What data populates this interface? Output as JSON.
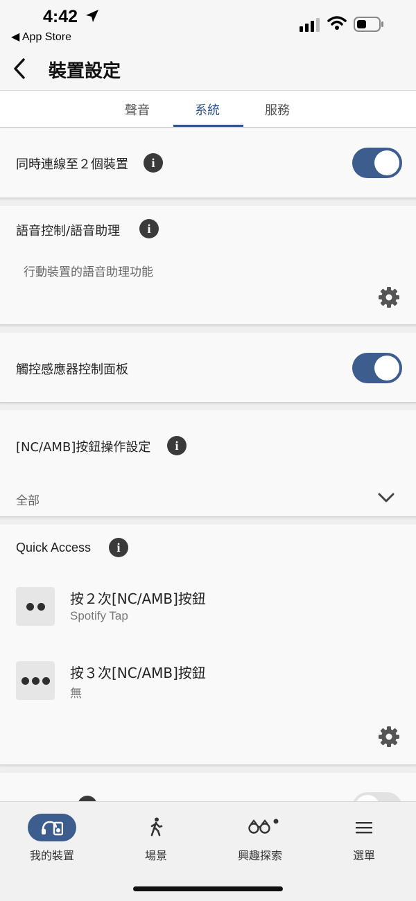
{
  "status_bar": {
    "time": "4:42",
    "back_app": "◀ App Store"
  },
  "header": {
    "title": "裝置設定"
  },
  "tabs": [
    {
      "label": "聲音",
      "active": false
    },
    {
      "label": "系統",
      "active": true
    },
    {
      "label": "服務",
      "active": false
    }
  ],
  "settings": {
    "dual_connect": {
      "label": "同時連線至２個裝置",
      "enabled": true
    },
    "voice": {
      "label": "語音控制/語音助理",
      "value": "行動裝置的語音助理功能"
    },
    "touch_panel": {
      "label": "觸控感應器控制面板",
      "enabled": true
    },
    "nc_amb": {
      "label": "[NC/AMB]按鈕操作設定",
      "selected": "全部"
    },
    "quick_access": {
      "label": "Quick Access",
      "items": [
        {
          "title": "按２次[NC/AMB]按鈕",
          "value": "Spotify Tap"
        },
        {
          "title": "按３次[NC/AMB]按鈕",
          "value": "無"
        }
      ]
    }
  },
  "bottom_nav": [
    {
      "label": "我的裝置",
      "icon": "headphones-device-icon",
      "active": true
    },
    {
      "label": "場景",
      "icon": "walking-person-icon",
      "active": false
    },
    {
      "label": "興趣探索",
      "icon": "binoculars-icon",
      "active": false
    },
    {
      "label": "選單",
      "icon": "hamburger-menu-icon",
      "active": false
    }
  ],
  "colors": {
    "accent": "#3c5d8e",
    "tab_active": "#2d5590"
  }
}
